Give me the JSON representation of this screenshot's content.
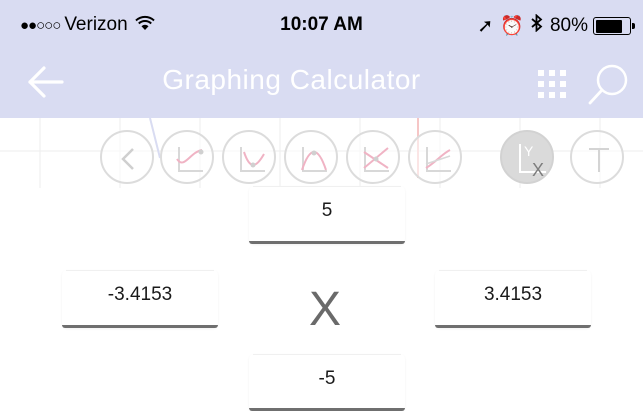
{
  "status_bar": {
    "signal": "●●○○○",
    "carrier": "Verizon",
    "wifi": "ᯤ",
    "time": "10:07 AM",
    "location_glyph": "➚",
    "alarm_glyph": "⏰",
    "bluetooth_glyph": "∦",
    "battery_level": 0.8,
    "battery_text": "80%"
  },
  "nav": {
    "title": "Graphing Calculator",
    "back_icon": "arrow-left-icon",
    "grid_icon": "grid-icon",
    "search_icon": "search-icon"
  },
  "toolbar": {
    "tools": [
      {
        "icon": "chevron-left-icon"
      },
      {
        "icon": "curve-point-icon"
      },
      {
        "icon": "minimum-icon"
      },
      {
        "icon": "maximum-icon"
      },
      {
        "icon": "intersection-icon"
      },
      {
        "icon": "derivative-icon"
      },
      {
        "icon": "axis-range-icon",
        "active": true
      },
      {
        "icon": "text-icon"
      }
    ]
  },
  "axis_range": {
    "y_max": "5",
    "y_min": "-5",
    "x_min": "-3.4153",
    "x_max": "3.4153",
    "axis_label": "X"
  },
  "colors": {
    "header_bg": "#d9dcf2",
    "tool_border": "#dcdcdc",
    "tool_icon": "#f0b3c4",
    "field_underline": "#6f6f6f"
  }
}
